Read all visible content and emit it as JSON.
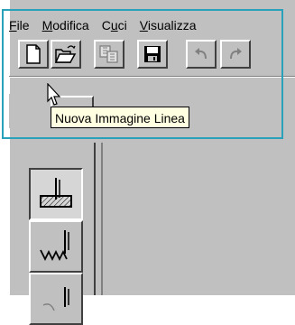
{
  "menubar": {
    "items": [
      {
        "pre": "",
        "mnemonic": "F",
        "post": "ile"
      },
      {
        "pre": "",
        "mnemonic": "M",
        "post": "odifica"
      },
      {
        "pre": "C",
        "mnemonic": "u",
        "post": "ci"
      },
      {
        "pre": "",
        "mnemonic": "V",
        "post": "isualizza"
      }
    ]
  },
  "toolbar": {
    "buttons": [
      "new-document",
      "open-folder",
      "copy-document",
      "save-disk",
      "undo",
      "redo"
    ]
  },
  "tooltip": {
    "text": "Nuova Immagine Linea"
  },
  "colors": {
    "highlight": "#2aa1ba",
    "tooltip_bg": "#ffffe1",
    "face": "#c0c0c0"
  }
}
